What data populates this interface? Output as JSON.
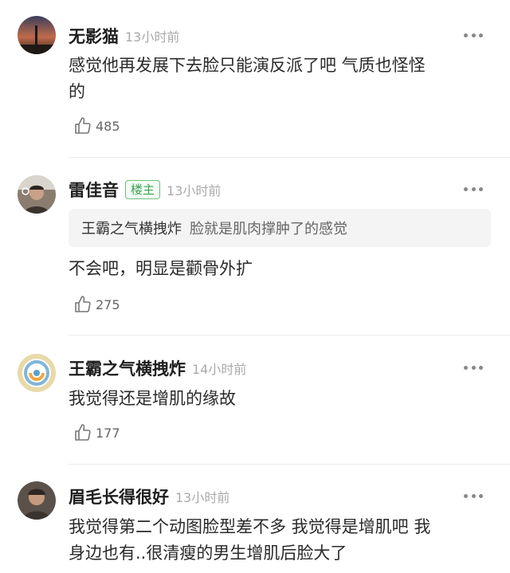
{
  "comments": [
    {
      "username": "无影猫",
      "time": "13小时前",
      "badge": "",
      "text_lines": [
        "感觉他再发展下去脸只能演反派了吧 气质也怪怪",
        "的"
      ],
      "likes": "485",
      "avatar_icon": "sunset-photo-avatar"
    },
    {
      "username": "雷佳音",
      "time": "13小时前",
      "badge": "楼主",
      "quote_author": "王霸之气横拽炸",
      "quote_text": "脸就是肌肉撑肿了的感觉",
      "text_lines": [
        "不会吧，明显是颧骨外扩"
      ],
      "likes": "275",
      "avatar_icon": "person-photo-avatar"
    },
    {
      "username": "王霸之气横拽炸",
      "time": "14小时前",
      "badge": "",
      "text_lines": [
        "我觉得还是增肌的缘故"
      ],
      "likes": "177",
      "avatar_icon": "swirl-avatar"
    },
    {
      "username": "眉毛长得很好",
      "time": "13小时前",
      "badge": "",
      "text_lines": [
        "我觉得第二个动图脸型差不多 我觉得是增肌吧 我",
        "身边也有..很清瘦的男生增肌后脸大了"
      ],
      "likes": "",
      "avatar_icon": "person-photo-avatar"
    }
  ],
  "icons": {
    "like": "thumbs-up-icon",
    "more": "more-dots-icon"
  },
  "colors": {
    "badge_green": "#3aa453",
    "time_gray": "#aaaaaa"
  }
}
